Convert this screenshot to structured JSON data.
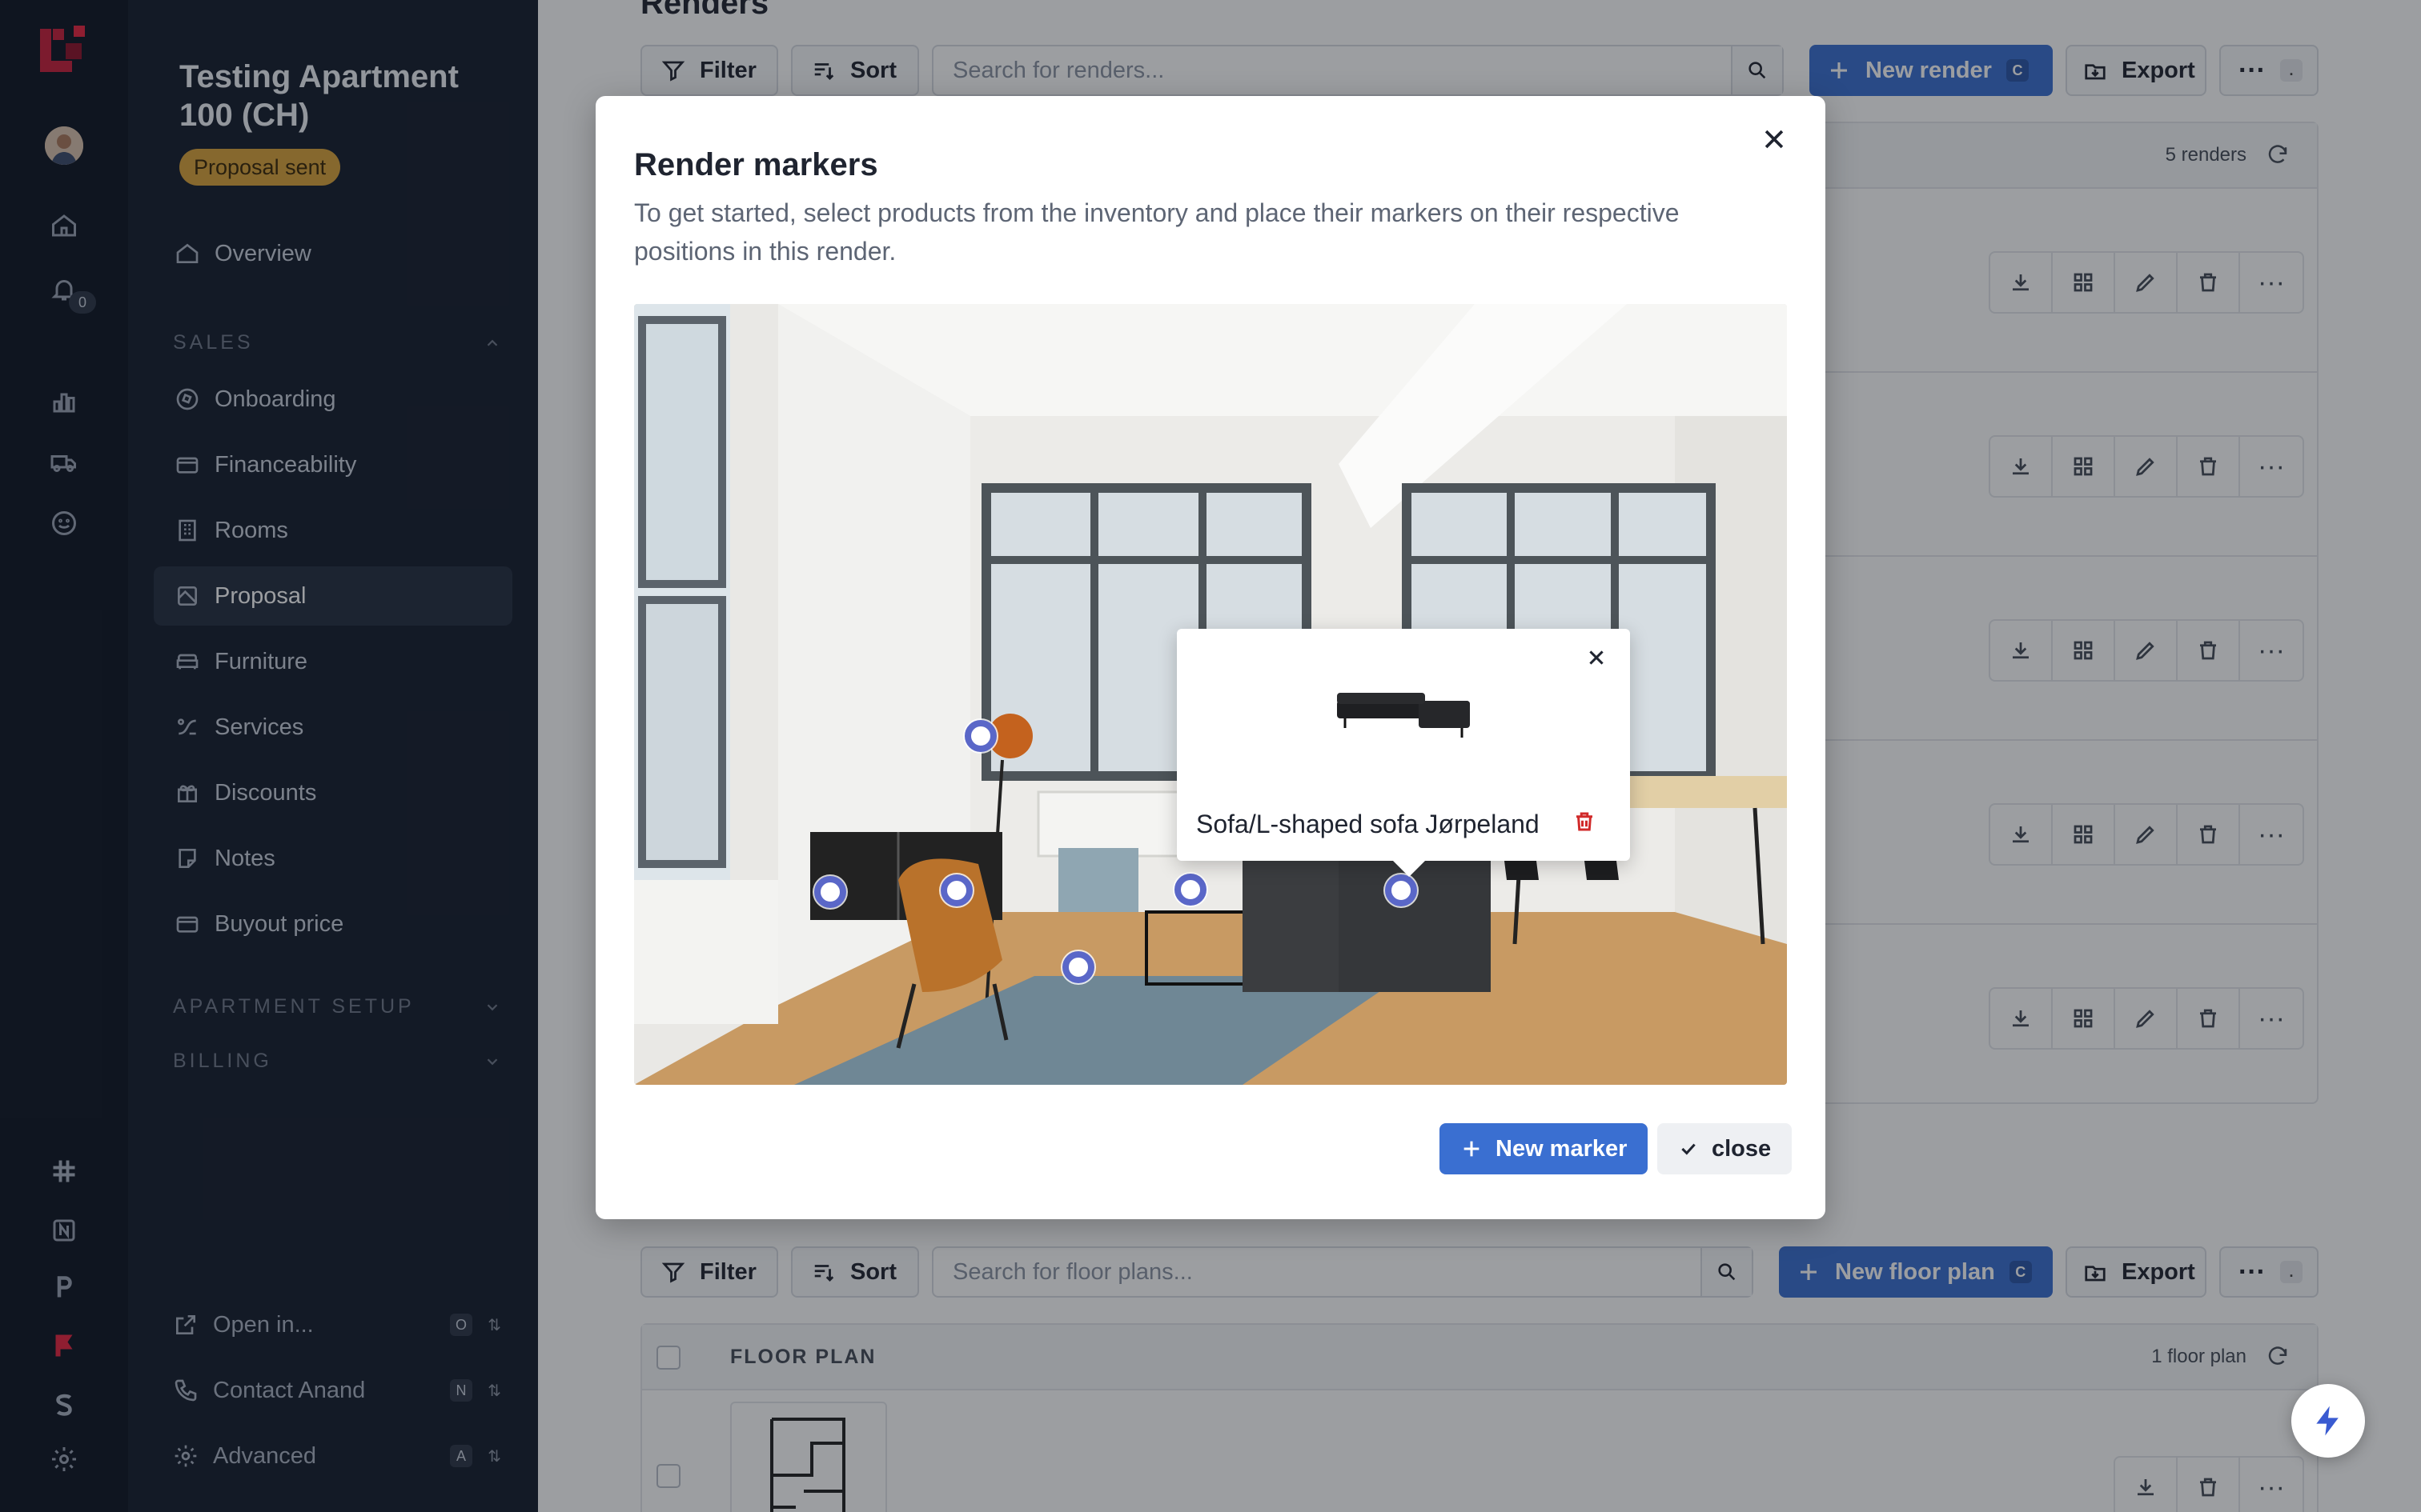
{
  "project": {
    "title": "Testing Apartment 100 (CH)",
    "status": "Proposal sent"
  },
  "rail": {
    "notification_count": "0"
  },
  "nav": {
    "overview": "Overview",
    "sales_section": "SALES",
    "items": [
      "Onboarding",
      "Financeability",
      "Rooms",
      "Proposal",
      "Furniture",
      "Services",
      "Discounts",
      "Notes",
      "Buyout price"
    ],
    "active_item": "Proposal",
    "apartment_setup_section": "APARTMENT SETUP",
    "billing_section": "BILLING"
  },
  "bottom": {
    "open_in": {
      "label": "Open in...",
      "key": "O"
    },
    "contact": {
      "label": "Contact Anand",
      "key": "N"
    },
    "advanced": {
      "label": "Advanced",
      "key": "A"
    }
  },
  "renders": {
    "heading": "Renders",
    "filter_label": "Filter",
    "sort_label": "Sort",
    "search_placeholder": "Search for renders...",
    "new_label": "New render",
    "new_key": "C",
    "export_label": "Export",
    "more_key": ".",
    "count": "5 renders"
  },
  "floorplans": {
    "filter_label": "Filter",
    "sort_label": "Sort",
    "search_placeholder": "Search for floor plans...",
    "new_label": "New floor plan",
    "new_key": "C",
    "export_label": "Export",
    "more_key": ".",
    "column_header": "FLOOR PLAN",
    "count": "1 floor plan"
  },
  "modal": {
    "title": "Render markers",
    "description": "To get started, select products from the inventory and place their markers on their respective positions in this render.",
    "popup_product": "Sofa/L-shaped sofa Jørpeland",
    "new_marker_label": "New marker",
    "close_label": "close"
  },
  "colors": {
    "accent": "#3a6fd1",
    "marker": "#5a67c8",
    "badge": "#d9a23a",
    "sidebar": "#141c2b"
  }
}
